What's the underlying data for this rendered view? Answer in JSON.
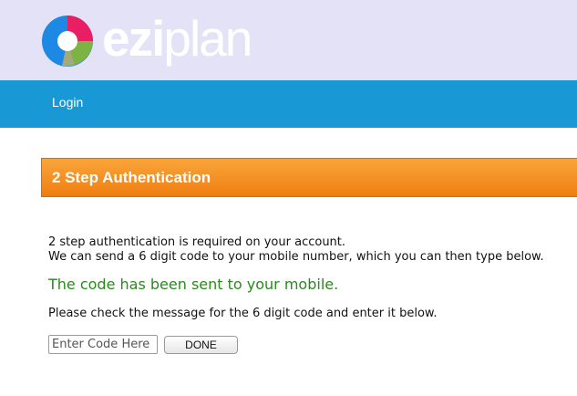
{
  "brand": {
    "logo_parts": [
      "ezi",
      "plan"
    ],
    "colors": {
      "header_bg": "#e4e2f6",
      "nav_bg": "#1899d6",
      "title_bar": "#f3891c",
      "success": "#2a8a1e"
    },
    "logo_ring_colors": [
      "#1e88e5",
      "#e91e63",
      "#7cb342",
      "#fbc02d"
    ]
  },
  "nav": {
    "login_label": "Login"
  },
  "auth": {
    "title": "2 Step Authentication",
    "intro_line1": "2 step authentication is required on your account.",
    "intro_line2": "We can send a 6 digit code to your mobile number, which you can then type below.",
    "status": "The code has been sent to your mobile.",
    "instruction": "Please check the message for the 6 digit code and enter it below.",
    "code_placeholder": "Enter Code Here",
    "code_value": "",
    "done_label": "DONE"
  }
}
